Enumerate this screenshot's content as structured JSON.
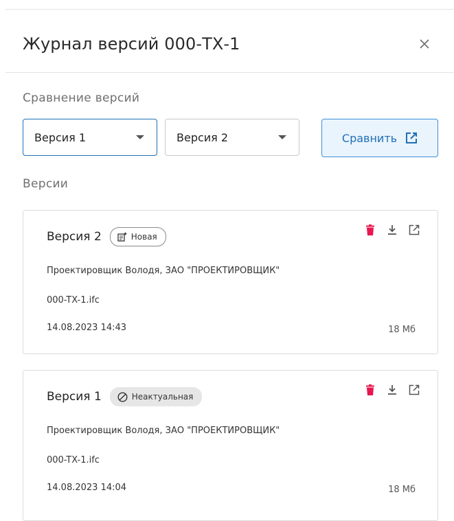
{
  "header": {
    "title": "Журнал версий 000-ТХ-1",
    "close_icon": "close-icon"
  },
  "compare": {
    "section_label": "Сравнение версий",
    "select1_value": "Версия 1",
    "select2_value": "Версия 2",
    "button_label": "Сравнить",
    "button_icon": "open-in-new-icon"
  },
  "versions": {
    "section_label": "Версии",
    "items": [
      {
        "title": "Версия 2",
        "badge": "Новая",
        "badge_icon": "new-document-icon",
        "author": "Проектировщик Володя, ЗАО \"ПРОЕКТИРОВЩИК\"",
        "file": "000-TX-1.ifc",
        "date": "14.08.2023 14:43",
        "size": "18 Мб"
      },
      {
        "title": "Версия 1",
        "badge": "Неактуальная",
        "badge_icon": "block-icon",
        "author": "Проектировщик Володя, ЗАО \"ПРОЕКТИРОВЩИК\"",
        "file": "000-TX-1.ifc",
        "date": "14.08.2023 14:04",
        "size": "18 Мб"
      }
    ]
  },
  "colors": {
    "accent": "#1f6fb5",
    "accent_bg": "#eaf4fd",
    "delete": "#e8174f"
  }
}
